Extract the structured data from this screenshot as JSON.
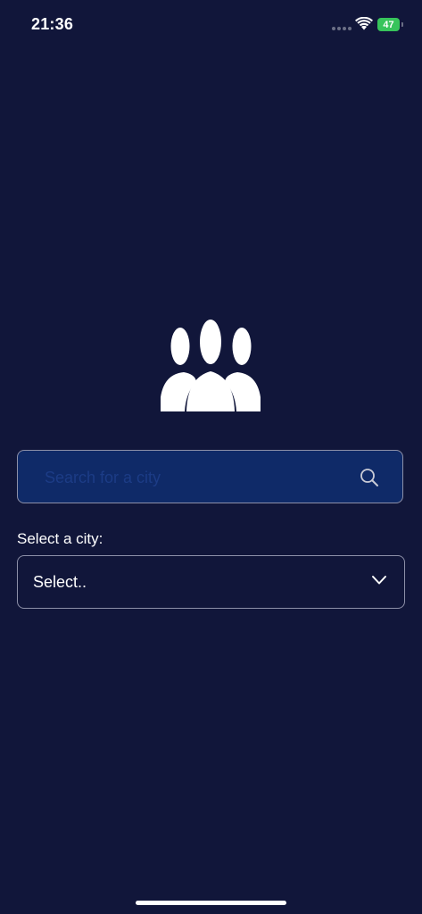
{
  "status_bar": {
    "time": "21:36",
    "battery": "47"
  },
  "search": {
    "placeholder": "Search for a city",
    "value": ""
  },
  "city_select": {
    "label": "Select a city:",
    "selected": "Select.."
  },
  "colors": {
    "background": "#11163a",
    "search_fill": "#0f2a68",
    "border": "#8d90a8",
    "battery": "#37c45b"
  },
  "icons": {
    "logo": "people-group-icon",
    "search": "search-icon",
    "dropdown": "chevron-down-icon",
    "wifi": "wifi-icon"
  }
}
